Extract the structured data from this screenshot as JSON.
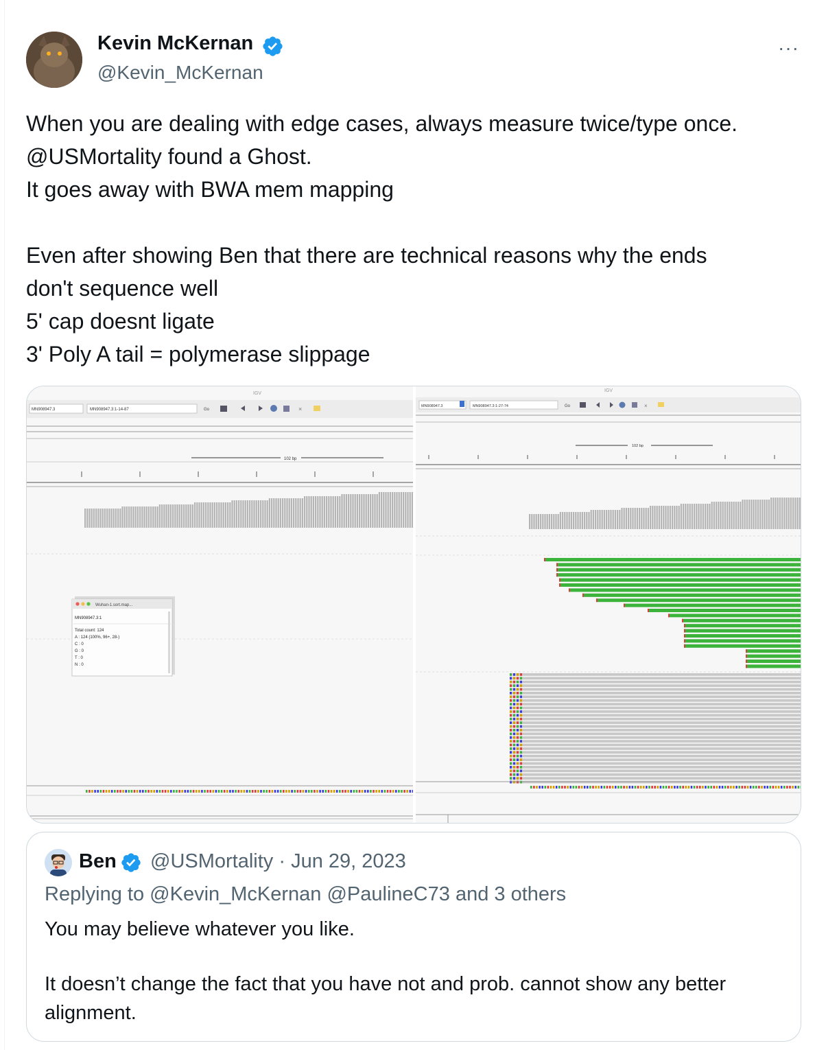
{
  "tweet": {
    "author_name": "Kevin McKernan",
    "author_handle": "@Kevin_McKernan",
    "more_label": "···",
    "lines": [
      "When you are dealing with edge cases, always measure twice/type once.",
      "@USMortality found a Ghost.",
      "It goes away with BWA mem mapping",
      "",
      "Even after showing Ben that there are technical reasons why the ends",
      "don't sequence well",
      "5' cap doesnt ligate",
      "3' Poly A tail = polymerase slippage"
    ]
  },
  "media": {
    "left_panel": {
      "window_title": "IGV",
      "locus_chip": "MN908947.3",
      "locus_field": "MN908947.3:1-14-87",
      "go_label": "Go",
      "scale_label": "102 bp",
      "popup": {
        "title": "Wuhan-1.sort.map...",
        "lines": [
          "MN908947.3:1",
          "Total count: 124",
          "A : 124 (100%, 96+, 28-)",
          "C : 0",
          "G : 0",
          "T : 0",
          "N : 0"
        ]
      }
    },
    "right_panel": {
      "window_title": "IGV",
      "locus_chip": "MN908947.3",
      "locus_field": "MN908947.3:1-27-74",
      "go_label": "Go",
      "scale_label": "102 bp"
    },
    "colors": {
      "coverage": "#b4b4b4",
      "reads_green": "#3cb43c",
      "reads_gray": "#c8c8c8",
      "A": "#3cb43c",
      "C": "#3c3cdc",
      "G": "#d2a000",
      "T": "#dc3c3c"
    }
  },
  "quote": {
    "author_name": "Ben",
    "author_handle": "@USMortality",
    "date": "· Jun 29, 2023",
    "replying_prefix": "Replying to",
    "replying_to": "@Kevin_McKernan @PaulineC73",
    "replying_suffix": "and 3 others",
    "lines": [
      "You may believe whatever you like.",
      "",
      "It doesn’t change the fact that you have not and prob. cannot show any better",
      "alignment."
    ]
  }
}
